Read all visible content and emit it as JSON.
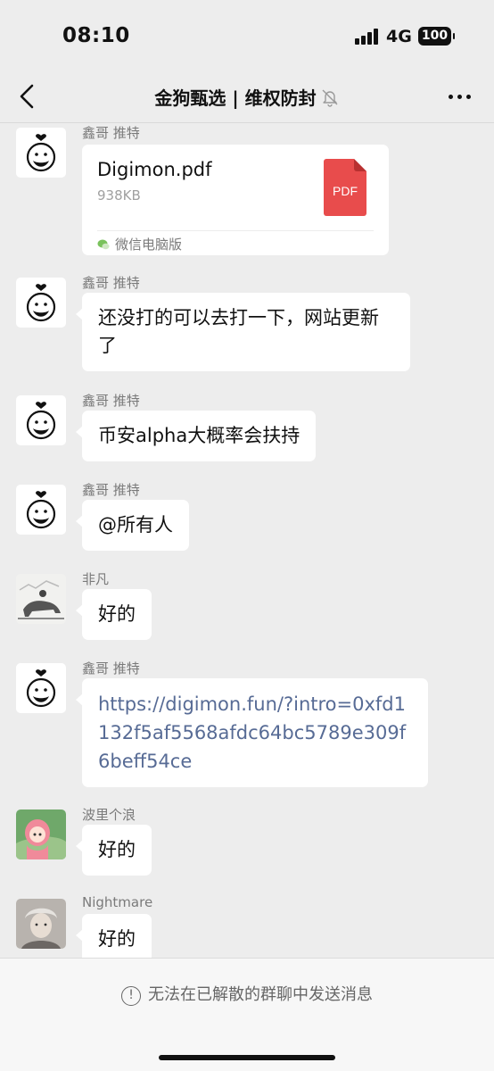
{
  "status": {
    "time": "08:10",
    "network": "4G",
    "battery": "100"
  },
  "header": {
    "title": "金狗甄选 | 维权防封"
  },
  "messages": [
    {
      "sender": "鑫哥 推特",
      "file_name": "Digimon.pdf",
      "file_size": "938KB",
      "file_type": "PDF",
      "file_source": "微信电脑版"
    },
    {
      "sender": "鑫哥 推特",
      "text": "还没打的可以去打一下，网站更新了"
    },
    {
      "sender": "鑫哥 推特",
      "text": "币安alpha大概率会扶持"
    },
    {
      "sender": "鑫哥 推特",
      "text": "@所有人"
    },
    {
      "sender": "非凡",
      "text": "好的"
    },
    {
      "sender": "鑫哥 推特",
      "text": "https://digimon.fun/?intro=0xfd1132f5af5568afdc64bc5789e309f6beff54ce"
    },
    {
      "sender": "波里个浪",
      "text": "好的"
    },
    {
      "sender": "Nightmare",
      "text": "好的"
    }
  ],
  "footer": {
    "notice": "无法在已解散的群聊中发送消息"
  },
  "colors": {
    "background": "#ededed",
    "bubble": "#ffffff",
    "link": "#576b95",
    "pdf": "#e84c4c"
  },
  "icons": [
    "back-icon",
    "mute-bell-icon",
    "more-icon",
    "pdf-file-icon",
    "wechat-pc-icon",
    "info-icon",
    "signal-icon",
    "battery-icon"
  ]
}
